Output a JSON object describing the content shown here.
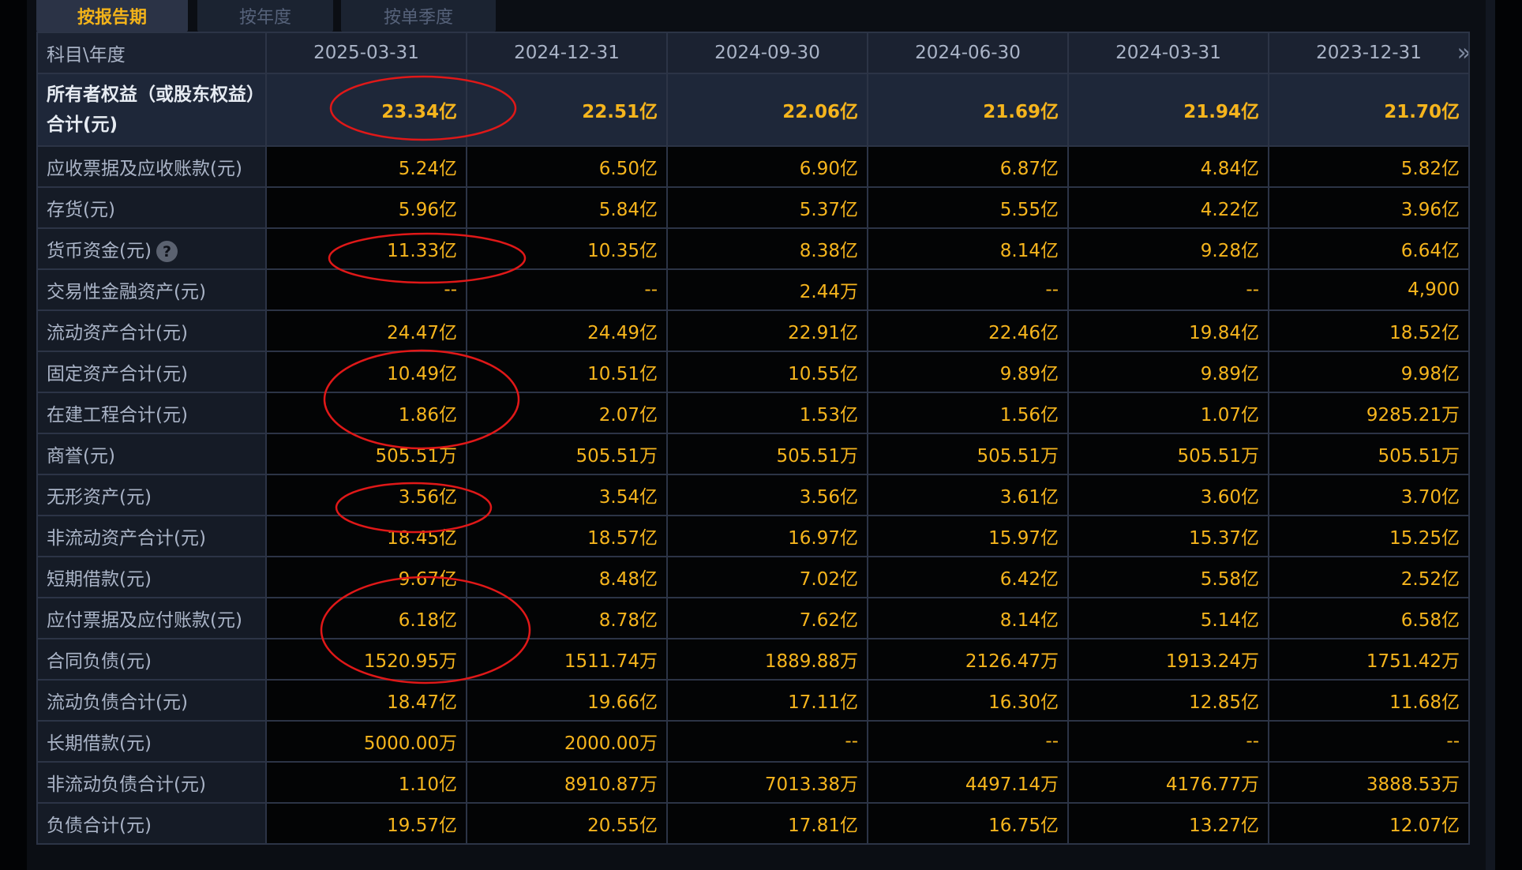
{
  "tabs": [
    "按报告期",
    "按年度",
    "按单季度"
  ],
  "table": {
    "corner_label": "科目\\年度",
    "columns": [
      "2025-03-31",
      "2024-12-31",
      "2024-09-30",
      "2024-06-30",
      "2024-03-31",
      "2023-12-31"
    ],
    "rows": [
      {
        "label": "所有者权益（或股东权益）合计(元)",
        "values": [
          "23.34亿",
          "22.51亿",
          "22.06亿",
          "21.69亿",
          "21.94亿",
          "21.70亿"
        ]
      },
      {
        "label": "应收票据及应收账款(元)",
        "values": [
          "5.24亿",
          "6.50亿",
          "6.90亿",
          "6.87亿",
          "4.84亿",
          "5.82亿"
        ]
      },
      {
        "label": "存货(元)",
        "values": [
          "5.96亿",
          "5.84亿",
          "5.37亿",
          "5.55亿",
          "4.22亿",
          "3.96亿"
        ]
      },
      {
        "label": "货币资金(元)",
        "values": [
          "11.33亿",
          "10.35亿",
          "8.38亿",
          "8.14亿",
          "9.28亿",
          "6.64亿"
        ]
      },
      {
        "label": "交易性金融资产(元)",
        "values": [
          "--",
          "--",
          "2.44万",
          "--",
          "--",
          "4,900"
        ]
      },
      {
        "label": "流动资产合计(元)",
        "values": [
          "24.47亿",
          "24.49亿",
          "22.91亿",
          "22.46亿",
          "19.84亿",
          "18.52亿"
        ]
      },
      {
        "label": "固定资产合计(元)",
        "values": [
          "10.49亿",
          "10.51亿",
          "10.55亿",
          "9.89亿",
          "9.89亿",
          "9.98亿"
        ]
      },
      {
        "label": "在建工程合计(元)",
        "values": [
          "1.86亿",
          "2.07亿",
          "1.53亿",
          "1.56亿",
          "1.07亿",
          "9285.21万"
        ]
      },
      {
        "label": "商誉(元)",
        "values": [
          "505.51万",
          "505.51万",
          "505.51万",
          "505.51万",
          "505.51万",
          "505.51万"
        ]
      },
      {
        "label": "无形资产(元)",
        "values": [
          "3.56亿",
          "3.54亿",
          "3.56亿",
          "3.61亿",
          "3.60亿",
          "3.70亿"
        ]
      },
      {
        "label": "非流动资产合计(元)",
        "values": [
          "18.45亿",
          "18.57亿",
          "16.97亿",
          "15.97亿",
          "15.37亿",
          "15.25亿"
        ]
      },
      {
        "label": "短期借款(元)",
        "values": [
          "9.67亿",
          "8.48亿",
          "7.02亿",
          "6.42亿",
          "5.58亿",
          "2.52亿"
        ]
      },
      {
        "label": "应付票据及应付账款(元)",
        "values": [
          "6.18亿",
          "8.78亿",
          "7.62亿",
          "8.14亿",
          "5.14亿",
          "6.58亿"
        ]
      },
      {
        "label": "合同负债(元)",
        "values": [
          "1520.95万",
          "1511.74万",
          "1889.88万",
          "2126.47万",
          "1913.24万",
          "1751.42万"
        ]
      },
      {
        "label": "流动负债合计(元)",
        "values": [
          "18.47亿",
          "19.66亿",
          "17.11亿",
          "16.30亿",
          "12.85亿",
          "11.68亿"
        ]
      },
      {
        "label": "长期借款(元)",
        "values": [
          "5000.00万",
          "2000.00万",
          "--",
          "--",
          "--",
          "--"
        ]
      },
      {
        "label": "非流动负债合计(元)",
        "values": [
          "1.10亿",
          "8910.87万",
          "7013.38万",
          "4497.14万",
          "4176.77万",
          "3888.53万"
        ]
      },
      {
        "label": "负债合计(元)",
        "values": [
          "19.57亿",
          "20.55亿",
          "17.81亿",
          "16.75亿",
          "13.27亿",
          "12.07亿"
        ]
      }
    ]
  },
  "icons": {
    "help": "?",
    "more": "»"
  },
  "colors": {
    "value": "#f6b51d",
    "annotation": "#e01818",
    "active_tab": "#f3b31a"
  }
}
